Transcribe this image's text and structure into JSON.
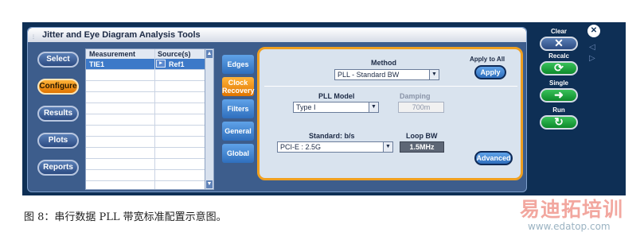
{
  "window": {
    "title": "Jitter and Eye Diagram Analysis Tools"
  },
  "sidebar": [
    {
      "label": "Select",
      "active": false
    },
    {
      "label": "Configure",
      "active": true
    },
    {
      "label": "Results",
      "active": false
    },
    {
      "label": "Plots",
      "active": false
    },
    {
      "label": "Reports",
      "active": false
    }
  ],
  "measurements": {
    "headers": [
      "Measurement",
      "Source(s)"
    ],
    "rows": [
      {
        "measurement": "TIE1",
        "source": "Ref1"
      }
    ]
  },
  "tabs": [
    {
      "label": "Edges",
      "active": false
    },
    {
      "label": "Clock Recovery",
      "lines": [
        "Clock",
        "Recovery"
      ],
      "active": true
    },
    {
      "label": "Filters",
      "active": false
    },
    {
      "label": "General",
      "active": false
    },
    {
      "label": "Global",
      "active": false
    }
  ],
  "panel": {
    "method_label": "Method",
    "method_value": "PLL - Standard BW",
    "apply_all_label": "Apply to All",
    "apply_button": "Apply",
    "pll_model_label": "PLL Model",
    "pll_model_value": "Type I",
    "damping_label": "Damping",
    "damping_value": "700m",
    "standard_label": "Standard: b/s",
    "standard_value": "PCI-E : 2.5G",
    "loop_bw_label": "Loop BW",
    "loop_bw_value": "1.5MHz",
    "advanced_button": "Advanced"
  },
  "right_controls": {
    "clear_label": "Clear",
    "recalc_label": "Recalc",
    "single_label": "Single",
    "run_label": "Run"
  },
  "colors": {
    "accent": "#f0a020",
    "panel_bg": "#d9e3ee",
    "recalc_green": "#17a23a"
  },
  "caption": "图 8：串行数据 PLL 带宽标准配置示意图。",
  "watermark": {
    "text": "易迪拓培训",
    "url": "www.edatop.com"
  }
}
